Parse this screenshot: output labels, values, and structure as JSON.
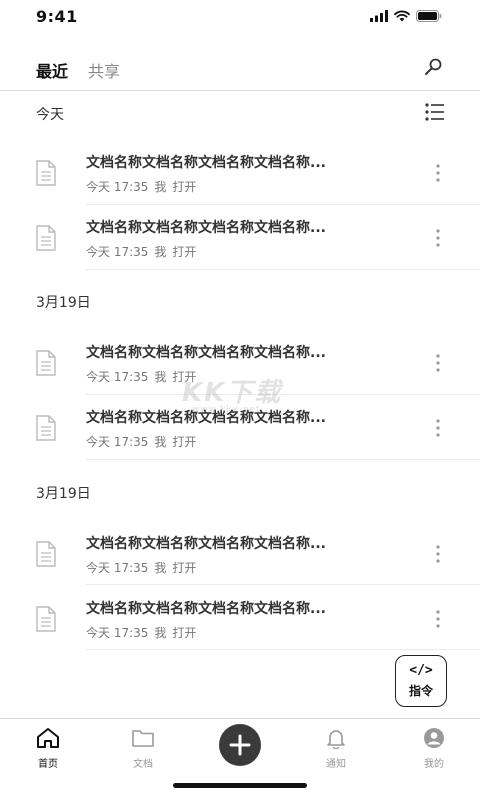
{
  "status_bar": {
    "time": "9:41"
  },
  "top_nav": {
    "tabs": [
      {
        "label": "最近",
        "active": true
      },
      {
        "label": "共享",
        "active": false
      }
    ]
  },
  "sections": [
    {
      "header": "今天",
      "docs": [
        {
          "title": "文档名称文档名称文档名称文档名称...",
          "time": "今天 17:35",
          "user": "我",
          "action": "打开"
        },
        {
          "title": "文档名称文档名称文档名称文档名称...",
          "time": "今天 17:35",
          "user": "我",
          "action": "打开"
        }
      ]
    },
    {
      "header": "3月19日",
      "docs": [
        {
          "title": "文档名称文档名称文档名称文档名称...",
          "time": "今天 17:35",
          "user": "我",
          "action": "打开"
        },
        {
          "title": "文档名称文档名称文档名称文档名称...",
          "time": "今天 17:35",
          "user": "我",
          "action": "打开"
        }
      ]
    },
    {
      "header": "3月19日",
      "docs": [
        {
          "title": "文档名称文档名称文档名称文档名称...",
          "time": "今天 17:35",
          "user": "我",
          "action": "打开"
        },
        {
          "title": "文档名称文档名称文档名称文档名称...",
          "time": "今天 17:35",
          "user": "我",
          "action": "打开"
        }
      ]
    }
  ],
  "command_button": {
    "code": "</>",
    "label": "指令"
  },
  "tab_bar": {
    "items": [
      {
        "label": "首页",
        "icon": "home-icon",
        "active": true
      },
      {
        "label": "文档",
        "icon": "folder-icon",
        "active": false
      },
      {
        "label": "",
        "icon": "plus-icon",
        "active": false
      },
      {
        "label": "通知",
        "icon": "bell-icon",
        "active": false
      },
      {
        "label": "我的",
        "icon": "user-icon",
        "active": false
      }
    ]
  },
  "watermark": {
    "main": "KK下载",
    "sub": "www.kkx.net"
  },
  "colors": {
    "text_primary": "#333333",
    "text_secondary": "#777777",
    "inactive_tab": "#888888",
    "add_button": "#3a3a3a"
  }
}
